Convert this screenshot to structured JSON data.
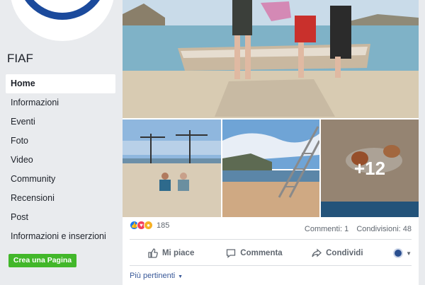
{
  "page": {
    "name": "FIAF"
  },
  "sidebar": {
    "items": [
      {
        "label": "Home",
        "active": true
      },
      {
        "label": "Informazioni"
      },
      {
        "label": "Eventi"
      },
      {
        "label": "Foto"
      },
      {
        "label": "Video"
      },
      {
        "label": "Community"
      },
      {
        "label": "Recensioni"
      },
      {
        "label": "Post"
      },
      {
        "label": "Informazioni e inserzioni"
      }
    ],
    "create_page": "Crea una Pagina"
  },
  "post": {
    "more_photos": "+12",
    "reactions_count": "185",
    "comments": "Commenti: 1",
    "shares": "Condivisioni: 48",
    "actions": {
      "like": "Mi piace",
      "comment": "Commenta",
      "share": "Condividi"
    },
    "sort_label": "Più pertinenti"
  },
  "colors": {
    "accent": "#385898",
    "create_button": "#42b72a",
    "like": "#1877f2",
    "love": "#f33e58",
    "wow": "#f7b125"
  }
}
